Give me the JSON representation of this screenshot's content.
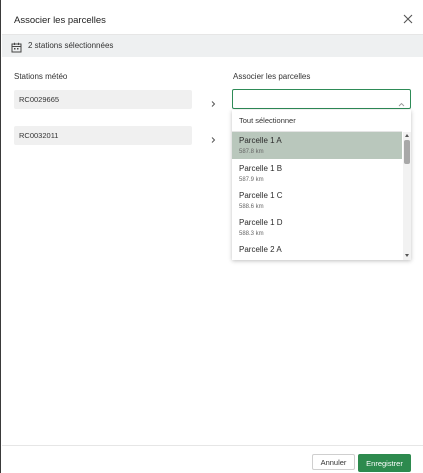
{
  "modal": {
    "title": "Associer les parcelles",
    "close_icon": "close-icon"
  },
  "banner": {
    "icon": "calendar-icon",
    "text": "2 stations sélectionnées"
  },
  "columns": {
    "stations_label": "Stations météo",
    "parcels_label": "Associer les parcelles"
  },
  "stations": [
    {
      "id": "RC0029665"
    },
    {
      "id": "RC0032011"
    }
  ],
  "parcel_select": {
    "value": "",
    "select_all": "Tout sélectionner",
    "options": [
      {
        "name": "Parcelle 1 A",
        "distance": "587.8 km",
        "selected": true
      },
      {
        "name": "Parcelle 1 B",
        "distance": "587.9 km",
        "selected": false
      },
      {
        "name": "Parcelle 1 C",
        "distance": "588.6 km",
        "selected": false
      },
      {
        "name": "Parcelle 1 D",
        "distance": "588.3 km",
        "selected": false
      },
      {
        "name": "Parcelle 2 A",
        "distance": "",
        "selected": false
      }
    ]
  },
  "footer": {
    "cancel_label": "Annuler",
    "save_label": "Enregistrer"
  },
  "colors": {
    "accent": "#2d8a4e",
    "selected_option": "#b9c7bc",
    "banner_bg": "#eef0f1"
  }
}
